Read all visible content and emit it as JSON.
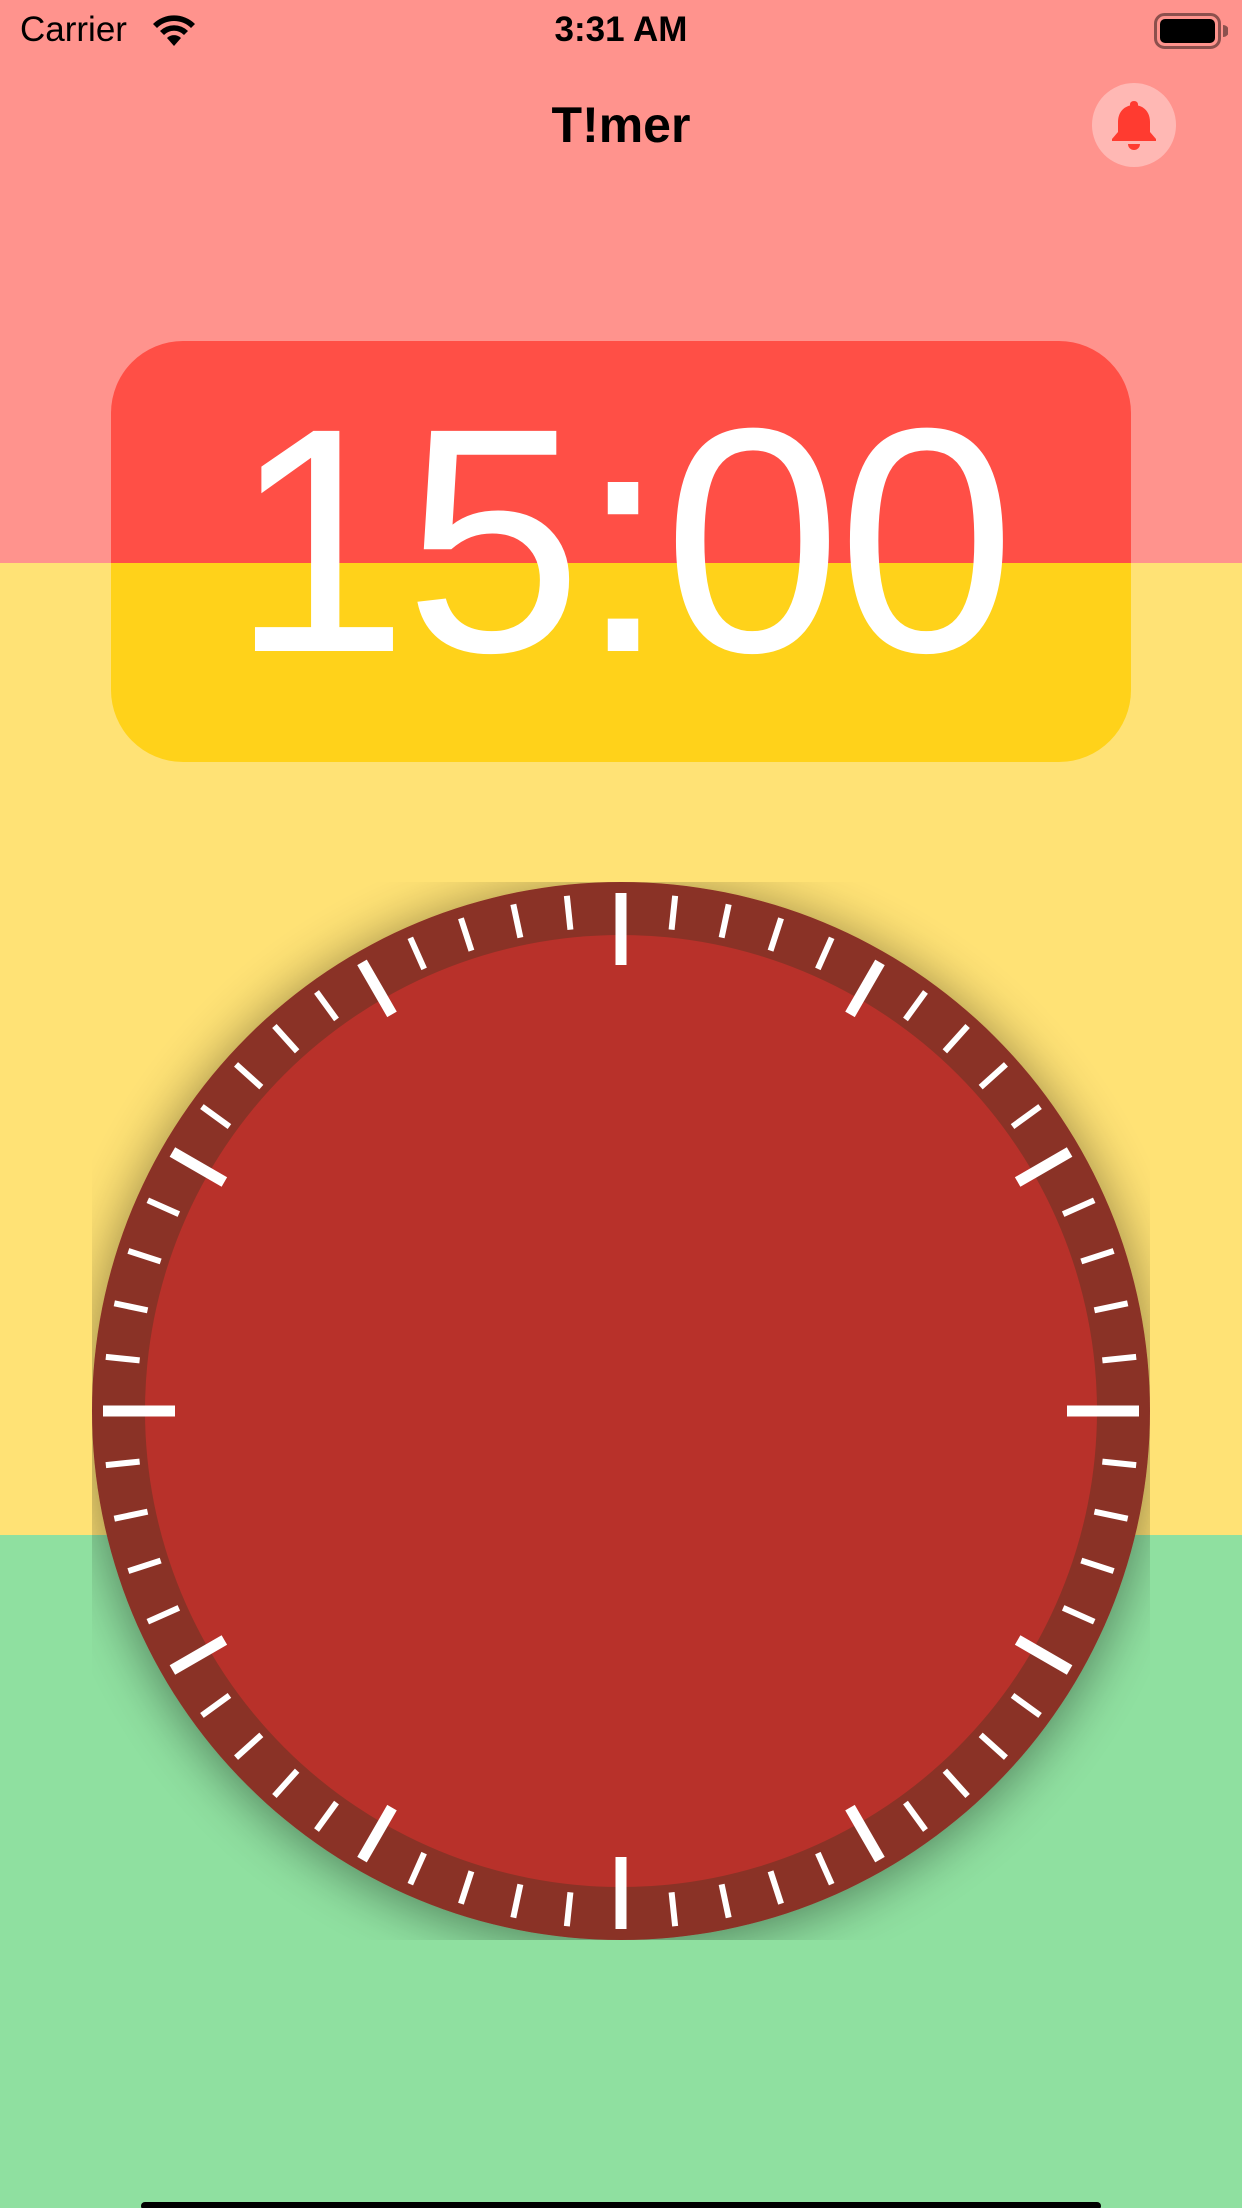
{
  "status_bar": {
    "carrier": "Carrier",
    "time": "3:31 AM",
    "wifi_icon": "wifi-icon",
    "battery_icon": "battery-full-icon"
  },
  "nav": {
    "title": "T!mer",
    "alarm_icon": "bell-icon"
  },
  "timer": {
    "display": "15:00"
  },
  "dial": {
    "tick_count": 60,
    "major_tick_every": 5,
    "cardinal_tick_every": 15
  },
  "colors": {
    "band_top": "#ff938d",
    "band_mid": "#ffe275",
    "band_bottom": "#8fe0a0",
    "card_top": "#ff4f46",
    "card_bottom": "#ffd21a",
    "dial_ring": "#8a3128",
    "dial_face": "#b8312a",
    "bell": "#ff3b30"
  }
}
